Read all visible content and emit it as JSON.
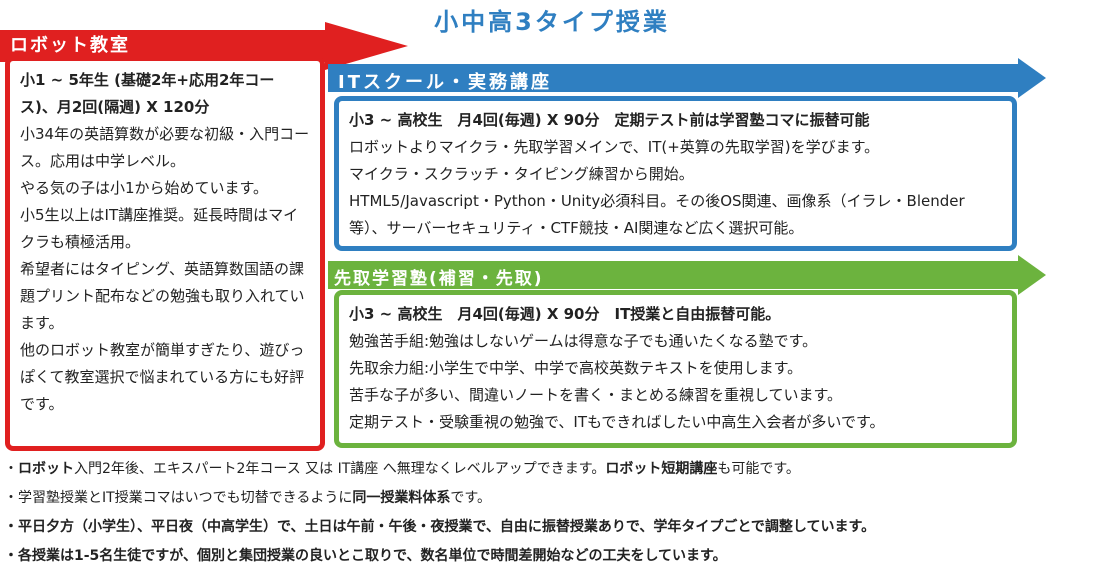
{
  "title": "小中高3タイプ授業",
  "colors": {
    "robot": "#e02020",
    "it": "#2f7fc1",
    "juku": "#6cb33e",
    "title": "#2f7fc1"
  },
  "robot": {
    "label": "ロボット教室",
    "header": "小1 ~ 5年生 (基礎2年+応用2年コース)、月2回(隔週) X 120分",
    "lines": [
      "小34年の英語算数が必要な初級・入門コース。応用は中学レベル。",
      "やる気の子は小1から始めています。",
      "小5生以上はIT講座推奨。延長時間はマイクラも積極活用。",
      "希望者にはタイピング、英語算数国語の課題プリント配布などの勉強も取り入れています。",
      "他のロボット教室が簡単すぎたり、遊びっぽくて教室選択で悩まれている方にも好評です。"
    ]
  },
  "it": {
    "label": "ITスクール・実務講座",
    "header": "小3 ~ 高校生　月4回(毎週) X 90分　定期テスト前は学習塾コマに振替可能",
    "lines": [
      "ロボットよりマイクラ・先取学習メインで、IT(+英算の先取学習)を学びます。",
      "マイクラ・スクラッチ・タイピング練習から開始。",
      "HTML5/Javascript・Python・Unity必須科目。その後OS関連、画像系（イラレ・Blender等）、サーバーセキュリティ・CTF競技・AI関連など広く選択可能。"
    ]
  },
  "juku": {
    "label": "先取学習塾(補習・先取)",
    "header": "小3 ~ 高校生　月4回(毎週) X 90分　IT授業と自由振替可能。",
    "lines": [
      "勉強苦手組:勉強はしないゲームは得意な子でも通いたくなる塾です。",
      "先取余力組:小学生で中学、中学で高校英数テキストを使用します。",
      "苦手な子が多い、間違いノートを書く・まとめる練習を重視しています。",
      "定期テスト・受験重視の勉強で、ITもできればしたい中高生入会者が多いです。"
    ]
  },
  "notes": [
    {
      "a": "・",
      "b1": "ロボット",
      "c": "入門2年後、エキスパート2年コース 又は IT講座 へ無理なくレベルアップできます。",
      "b2": "ロボット短期講座",
      "d": "も可能です。"
    },
    {
      "a": "・学習塾授業とIT授業コマはいつでも切替できるように",
      "b1": "同一授業料体系",
      "c": "です。",
      "b2": "",
      "d": ""
    },
    {
      "a": "",
      "b1": "・平日夕方（小学生）、平日夜（中高学生）で、土日は午前・午後・夜授業で、自由に振替授業ありで、学年タイプごとで調整しています。",
      "c": "",
      "b2": "",
      "d": ""
    },
    {
      "a": "",
      "b1": "・各授業は1-5名生徒ですが、個別と集団授業の良いとこ取りで、数名単位で時間差開始などの工夫をしています。",
      "c": "",
      "b2": "",
      "d": ""
    }
  ]
}
